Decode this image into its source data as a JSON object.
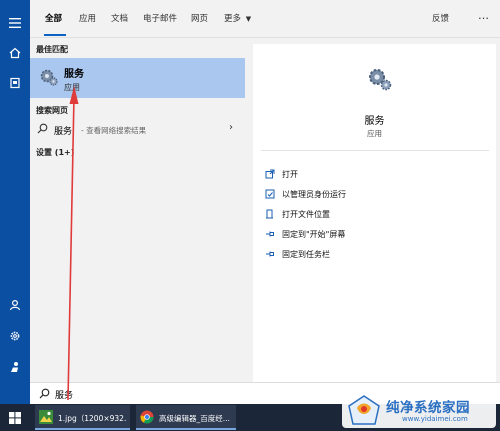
{
  "tabs": {
    "items": [
      {
        "label": "全部",
        "active": true
      },
      {
        "label": "应用"
      },
      {
        "label": "文档"
      },
      {
        "label": "电子邮件"
      },
      {
        "label": "网页"
      },
      {
        "label": "更多"
      }
    ],
    "feedback_label": "反馈",
    "more_menu": "…"
  },
  "results": {
    "best_match_heading": "最佳匹配",
    "best_match": {
      "title": "服务",
      "subtitle": "应用",
      "icon": "services-gear-icon"
    },
    "web_heading": "搜索网页",
    "web_item": {
      "query": "服务",
      "suffix": " - 查看网络搜索结果"
    },
    "settings_heading": "设置 (1+)"
  },
  "detail": {
    "name": "服务",
    "type": "应用",
    "actions": [
      {
        "label": "打开",
        "icon": "open-icon"
      },
      {
        "label": "以管理员身份运行",
        "icon": "run-as-admin-icon"
      },
      {
        "label": "打开文件位置",
        "icon": "file-location-icon"
      },
      {
        "label": "固定到\"开始\"屏幕",
        "icon": "pin-start-icon"
      },
      {
        "label": "固定到任务栏",
        "icon": "pin-taskbar-icon"
      }
    ]
  },
  "search": {
    "value": "服务"
  },
  "taskbar": {
    "items": [
      {
        "label": "1.jpg（1200×932...",
        "icon": "image-viewer-icon"
      },
      {
        "label": "高级编辑器_百度经...",
        "icon": "chrome-icon"
      }
    ]
  },
  "watermark": {
    "title": "纯净系统家园",
    "url": "www.yidaimei.com"
  },
  "colors": {
    "rail": "#0b4fa3",
    "highlight": "#a9c7ef",
    "taskbar": "#1b2638",
    "accent": "#0b61c4",
    "arrow": "#e03a3a"
  }
}
